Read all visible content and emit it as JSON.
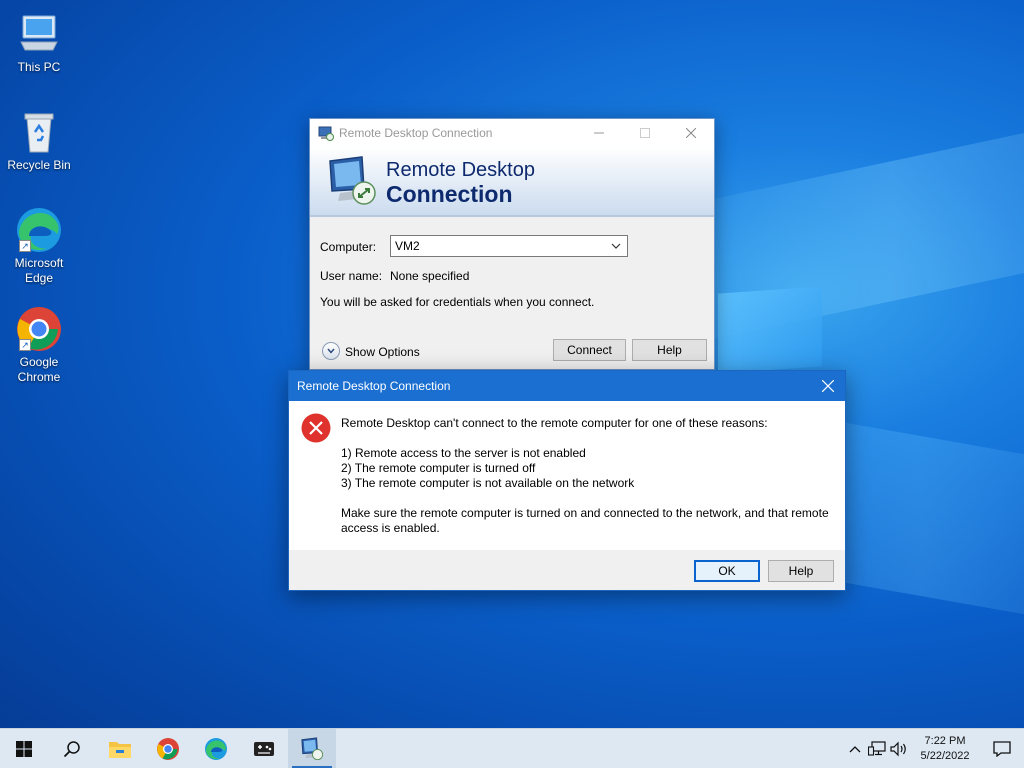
{
  "desktop": {
    "icons": [
      {
        "label": "This PC",
        "icon": "this-pc-icon"
      },
      {
        "label": "Recycle Bin",
        "icon": "recycle-bin-icon"
      },
      {
        "label": "Microsoft Edge",
        "icon": "edge-icon"
      },
      {
        "label": "Google Chrome",
        "icon": "chrome-icon"
      }
    ]
  },
  "rdc_window": {
    "title": "Remote Desktop Connection",
    "banner_line1": "Remote Desktop",
    "banner_line2": "Connection",
    "computer_label": "Computer:",
    "computer_value": "VM2",
    "username_label": "User name:",
    "username_value": "None specified",
    "credentials_note": "You will be asked for credentials when you connect.",
    "show_options": "Show Options",
    "connect_label": "Connect",
    "help_label": "Help"
  },
  "error_dialog": {
    "title": "Remote Desktop Connection",
    "message_intro": "Remote Desktop can't connect to the remote computer for one of these reasons:",
    "reasons": [
      "1) Remote access to the server is not enabled",
      "2) The remote computer is turned off",
      "3) The remote computer is not available on the network"
    ],
    "advice_line1": "Make sure the remote computer is turned on and connected to the network, and that remote",
    "advice_line2": "access is enabled.",
    "ok_label": "OK",
    "help_label": "Help"
  },
  "taskbar": {
    "apps": [
      "start-icon",
      "search-icon",
      "file-explorer-icon",
      "chrome-icon",
      "edge-icon",
      "game-controller-icon",
      "remote-desktop-icon"
    ],
    "clock_time": "7:22 PM",
    "clock_date": "5/22/2022"
  },
  "colors": {
    "accent": "#1a6fd0",
    "error_red": "#e0322d",
    "banner_text": "#0e2a6e"
  }
}
